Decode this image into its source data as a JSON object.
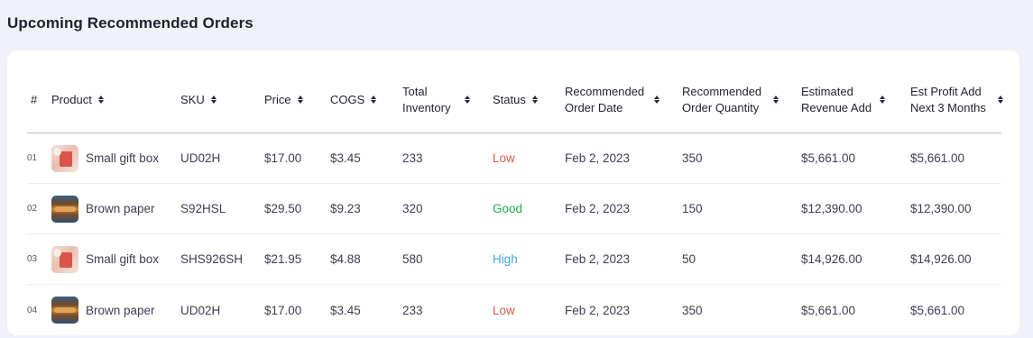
{
  "page": {
    "title": "Upcoming Recommended Orders"
  },
  "colors": {
    "low": "#e05a4e",
    "good": "#1fae48",
    "high": "#3ca8e3"
  },
  "table": {
    "headers": {
      "index": "#",
      "product": "Product",
      "sku": "SKU",
      "price": "Price",
      "cogs": "COGS",
      "total_inventory": "Total Inventory",
      "status": "Status",
      "order_date": "Recommended Order Date",
      "order_qty": "Recommended Order Quantity",
      "revenue_add": "Estimated Revenue Add",
      "profit_add": "Est Profit Add Next 3 Months"
    },
    "rows": [
      {
        "index": "01",
        "product": "Small gift box",
        "icon": "gift-box-thumbnail",
        "sku": "UD02H",
        "price": "$17.00",
        "cogs": "$3.45",
        "inventory": "233",
        "status": "Low",
        "order_date": "Feb 2, 2023",
        "order_qty": "350",
        "revenue_add": "$5,661.00",
        "profit_add": "$5,661.00"
      },
      {
        "index": "02",
        "product": "Brown paper",
        "icon": "brown-paper-thumbnail",
        "sku": "S92HSL",
        "price": "$29.50",
        "cogs": "$9.23",
        "inventory": "320",
        "status": "Good",
        "order_date": "Feb 2, 2023",
        "order_qty": "150",
        "revenue_add": "$12,390.00",
        "profit_add": "$12,390.00"
      },
      {
        "index": "03",
        "product": "Small gift box",
        "icon": "gift-box-thumbnail",
        "sku": "SHS926SH",
        "price": "$21.95",
        "cogs": "$4.88",
        "inventory": "580",
        "status": "High",
        "order_date": "Feb 2, 2023",
        "order_qty": "50",
        "revenue_add": "$14,926.00",
        "profit_add": "$14,926.00"
      },
      {
        "index": "04",
        "product": "Brown paper",
        "icon": "brown-paper-thumbnail",
        "sku": "UD02H",
        "price": "$17.00",
        "cogs": "$3.45",
        "inventory": "233",
        "status": "Low",
        "order_date": "Feb 2, 2023",
        "order_qty": "350",
        "revenue_add": "$5,661.00",
        "profit_add": "$5,661.00"
      }
    ]
  }
}
